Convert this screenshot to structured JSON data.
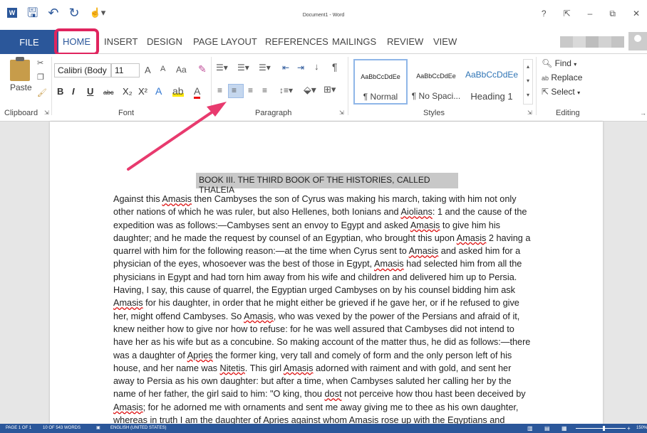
{
  "window": {
    "title": "Document1 - Word",
    "controls": [
      "?",
      "⇱",
      "–",
      "⧉",
      "✕"
    ]
  },
  "qat": {
    "save_icon": "save-icon",
    "undo_icon": "undo-icon",
    "redo_icon": "redo-icon",
    "touch_icon": "touch-mode-icon"
  },
  "tabs": [
    "FILE",
    "HOME",
    "INSERT",
    "DESIGN",
    "PAGE LAYOUT",
    "REFERENCES",
    "MAILINGS",
    "REVIEW",
    "VIEW"
  ],
  "ribbon": {
    "clipboard": {
      "paste_label": "Paste",
      "group_label": "Clipboard"
    },
    "font": {
      "font_name": "Calibri (Body",
      "font_size": "11",
      "grow": "A",
      "shrink": "A",
      "case": "Aa",
      "bold": "B",
      "italic": "I",
      "underline": "U",
      "strike": "abc",
      "subscript": "X₂",
      "superscript": "X²",
      "group_label": "Font"
    },
    "paragraph": {
      "group_label": "Paragraph"
    },
    "styles": {
      "items": [
        {
          "sample": "AaBbCcDdEe",
          "name": "¶ Normal"
        },
        {
          "sample": "AaBbCcDdEe",
          "name": "¶ No Spaci..."
        },
        {
          "sample": "AaBbCcDdEe",
          "name": "Heading 1"
        }
      ],
      "group_label": "Styles"
    },
    "editing": {
      "find": "Find",
      "replace": "Replace",
      "select": "Select",
      "group_label": "Editing"
    }
  },
  "document": {
    "heading": "BOOK III. THE THIRD BOOK OF THE HISTORIES, CALLED THALEIA",
    "lines": [
      "Against this Amasis then Cambyses the son of Cyrus was making his march, taking with him not only",
      "other nations of which he was ruler, but also Hellenes, both Ionians and Aiolians: 1 and the cause of the",
      "expedition was as follows:—Cambyses sent an envoy to Egypt and asked Amasis to give him his",
      "daughter; and he made the request by counsel of an Egyptian, who brought this upon Amasis 2 having a",
      "quarrel with him for the following reason:—at the time when Cyrus sent to Amasis and asked him for a",
      "physician of the eyes, whosoever was the best of those in Egypt, Amasis had selected him from all the",
      "physicians in Egypt and had torn him away from his wife and children and delivered him up to Persia.",
      "Having, I say, this cause of quarrel, the Egyptian urged Cambyses on by his counsel bidding him ask",
      "Amasis for his daughter, in order that he might either be grieved if he gave her, or if he refused to give",
      "her, might offend Cambyses. So Amasis, who was vexed by the power of the Persians and afraid of it,",
      "knew neither how to give nor how to refuse: for he was well assured that Cambyses did not intend to",
      "have her as his wife but as a concubine. So making account of the matter thus, he did as follows:—there",
      "was a daughter of Apries the former king, very tall and comely of form and the only person left of his",
      "house, and her name was Nitetis. This girl Amasis adorned with raiment and with gold, and sent her",
      "away to Persia as his own daughter: but after a time, when Cambyses saluted her calling her by the",
      "name of her father, the girl said to him: \"O king, thou dost not perceive how thou hast been deceived by",
      "Amasis; for he adorned me with ornaments and sent me away giving me to thee as his own daughter,",
      "whereas in truth I am the daughter of Apries against whom Amasis rose up with the Egyptians and"
    ]
  },
  "status": {
    "page": "PAGE 1 OF 1",
    "words": "10 OF 543 WORDS",
    "language": "ENGLISH (UNITED STATES)",
    "zoom": "150%"
  },
  "colors": {
    "accent": "#2b579a",
    "highlight_box": "#e0245e",
    "arrow": "#e83a6e"
  }
}
